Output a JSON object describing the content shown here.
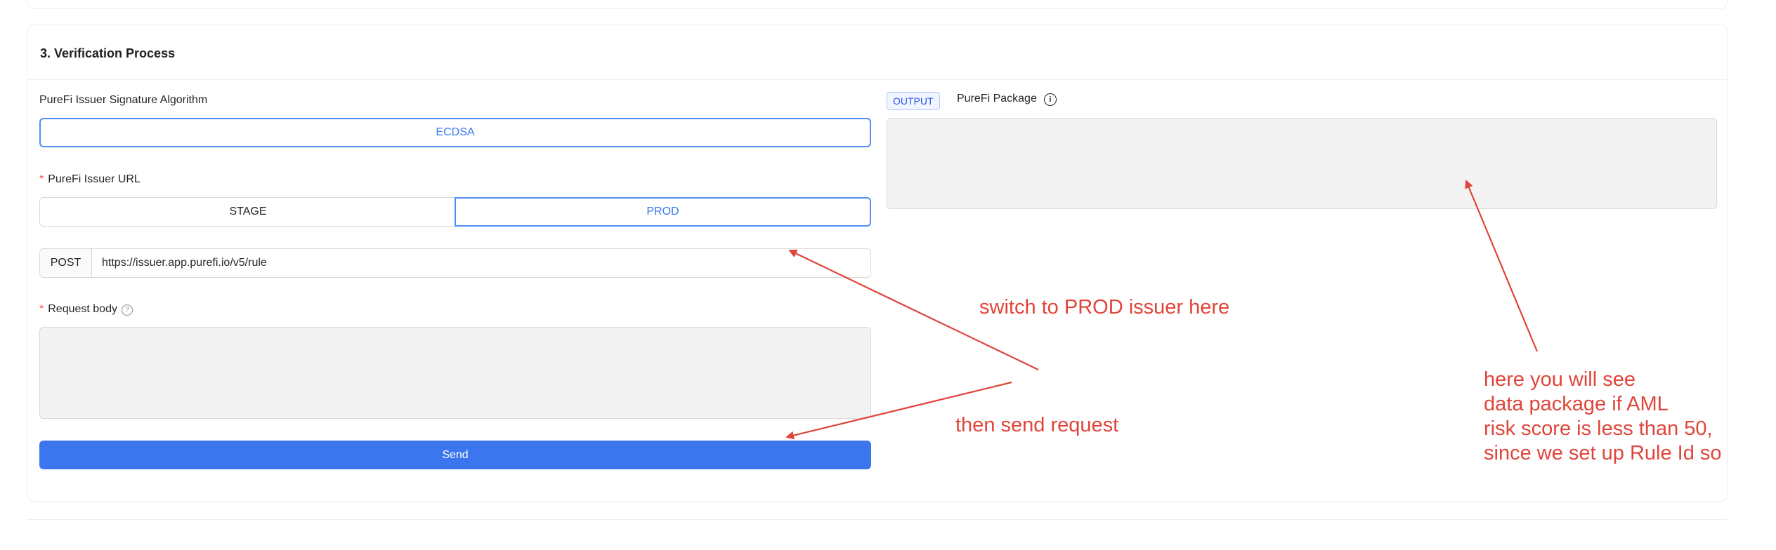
{
  "section": {
    "title": "3. Verification Process"
  },
  "left": {
    "algorithm_label": "PureFi Issuer Signature Algorithm",
    "algorithm_value": "ECDSA",
    "issuer_url_label": "PureFi Issuer URL",
    "issuer_options": [
      "STAGE",
      "PROD"
    ],
    "issuer_selected": "PROD",
    "method": "POST",
    "url": "https://issuer.app.purefi.io/v5/rule",
    "request_body_label": "Request body",
    "request_body_value": "",
    "send_label": "Send"
  },
  "right": {
    "output_tag": "OUTPUT",
    "package_label": "PureFi Package",
    "package_value": ""
  },
  "annotations": {
    "switch_prod": "switch to PROD issuer here",
    "send_request": "then send request",
    "output_note": [
      "here you will see",
      "data package if AML",
      "risk score is less than 50,",
      "since we set up Rule Id so"
    ]
  },
  "colors": {
    "primary": "#3b76ee",
    "annotation": "#e0453a",
    "required": "#ff4d4f"
  }
}
